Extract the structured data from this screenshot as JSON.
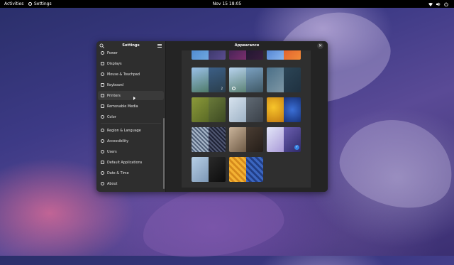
{
  "topbar": {
    "activities": "Activities",
    "app_name": "Settings",
    "clock": "Nov 15  18:05",
    "tray_icons": [
      "network-icon",
      "volume-icon",
      "power-icon"
    ]
  },
  "sidebar": {
    "title": "Settings",
    "items": [
      {
        "label": "Power",
        "icon": "power-icon"
      },
      {
        "label": "Displays",
        "icon": "display-icon"
      },
      {
        "label": "Mouse & Touchpad",
        "icon": "mouse-icon"
      },
      {
        "label": "Keyboard",
        "icon": "keyboard-icon"
      },
      {
        "label": "Printers",
        "icon": "printer-icon",
        "hovered": true
      },
      {
        "label": "Removable Media",
        "icon": "usb-icon"
      },
      {
        "label": "Color",
        "icon": "color-icon"
      },
      {
        "label": "Region & Language",
        "icon": "region-icon"
      },
      {
        "label": "Accessibility",
        "icon": "accessibility-icon"
      },
      {
        "label": "Users",
        "icon": "users-icon"
      },
      {
        "label": "Default Applications",
        "icon": "star-icon"
      },
      {
        "label": "Date & Time",
        "icon": "clock-icon"
      },
      {
        "label": "About",
        "icon": "info-icon"
      }
    ]
  },
  "content": {
    "title": "Appearance",
    "wallpapers_count_badge": "2",
    "colors": {
      "accent": "#3584e4",
      "panel": "#242424",
      "sidebar": "#2e2e2e"
    }
  }
}
